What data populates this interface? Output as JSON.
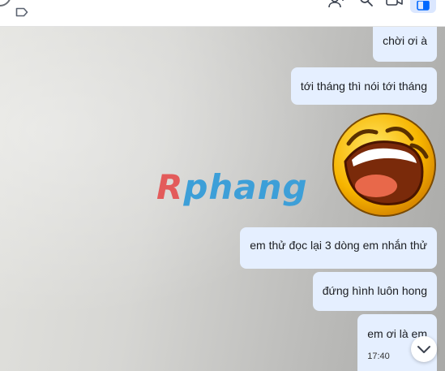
{
  "icons": {
    "tag": "tag-icon",
    "add_member": "add-member-icon",
    "search": "search-icon",
    "video": "video-call-icon",
    "sidebar": "sidebar-toggle-icon",
    "scroll_down": "chevron-down-icon"
  },
  "colors": {
    "bubble": "#e5efff",
    "accent": "#0068ff",
    "watermark_r": "#e35b5b",
    "watermark_rest": "#3d9fd8"
  },
  "watermark": {
    "first": "R",
    "rest": "phang"
  },
  "messages": [
    {
      "text": "chời ơi à"
    },
    {
      "text": "tới tháng thì nói tới tháng"
    },
    {
      "text": "em thử đọc lại 3 dòng em nhắn thử"
    },
    {
      "text": "đứng hình luôn hong"
    },
    {
      "text": "em ơi là em",
      "time": "17:40"
    }
  ],
  "sticker": "laughing-face-sticker"
}
